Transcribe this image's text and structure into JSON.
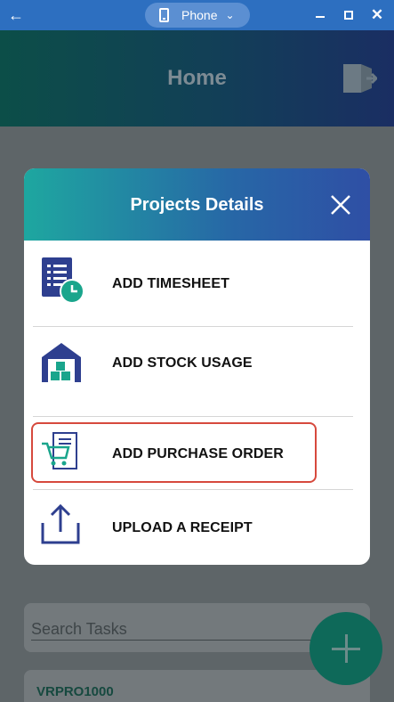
{
  "window": {
    "device_label": "Phone"
  },
  "app": {
    "title": "Home"
  },
  "modal": {
    "title": "Projects Details",
    "items": [
      {
        "label": "ADD TIMESHEET"
      },
      {
        "label": "ADD STOCK USAGE"
      },
      {
        "label": "ADD PURCHASE ORDER"
      },
      {
        "label": "UPLOAD A RECEIPT"
      }
    ]
  },
  "search": {
    "placeholder": "Search Tasks"
  },
  "project": {
    "code": "VRPRO1000"
  },
  "colors": {
    "titlebar": "#2d6fc0",
    "modal_gradient_start": "#1ea7a0",
    "modal_gradient_end": "#2f4fa5",
    "icon_navy": "#2e3f8f",
    "icon_teal": "#1aa58c",
    "highlight": "#d6493d"
  }
}
